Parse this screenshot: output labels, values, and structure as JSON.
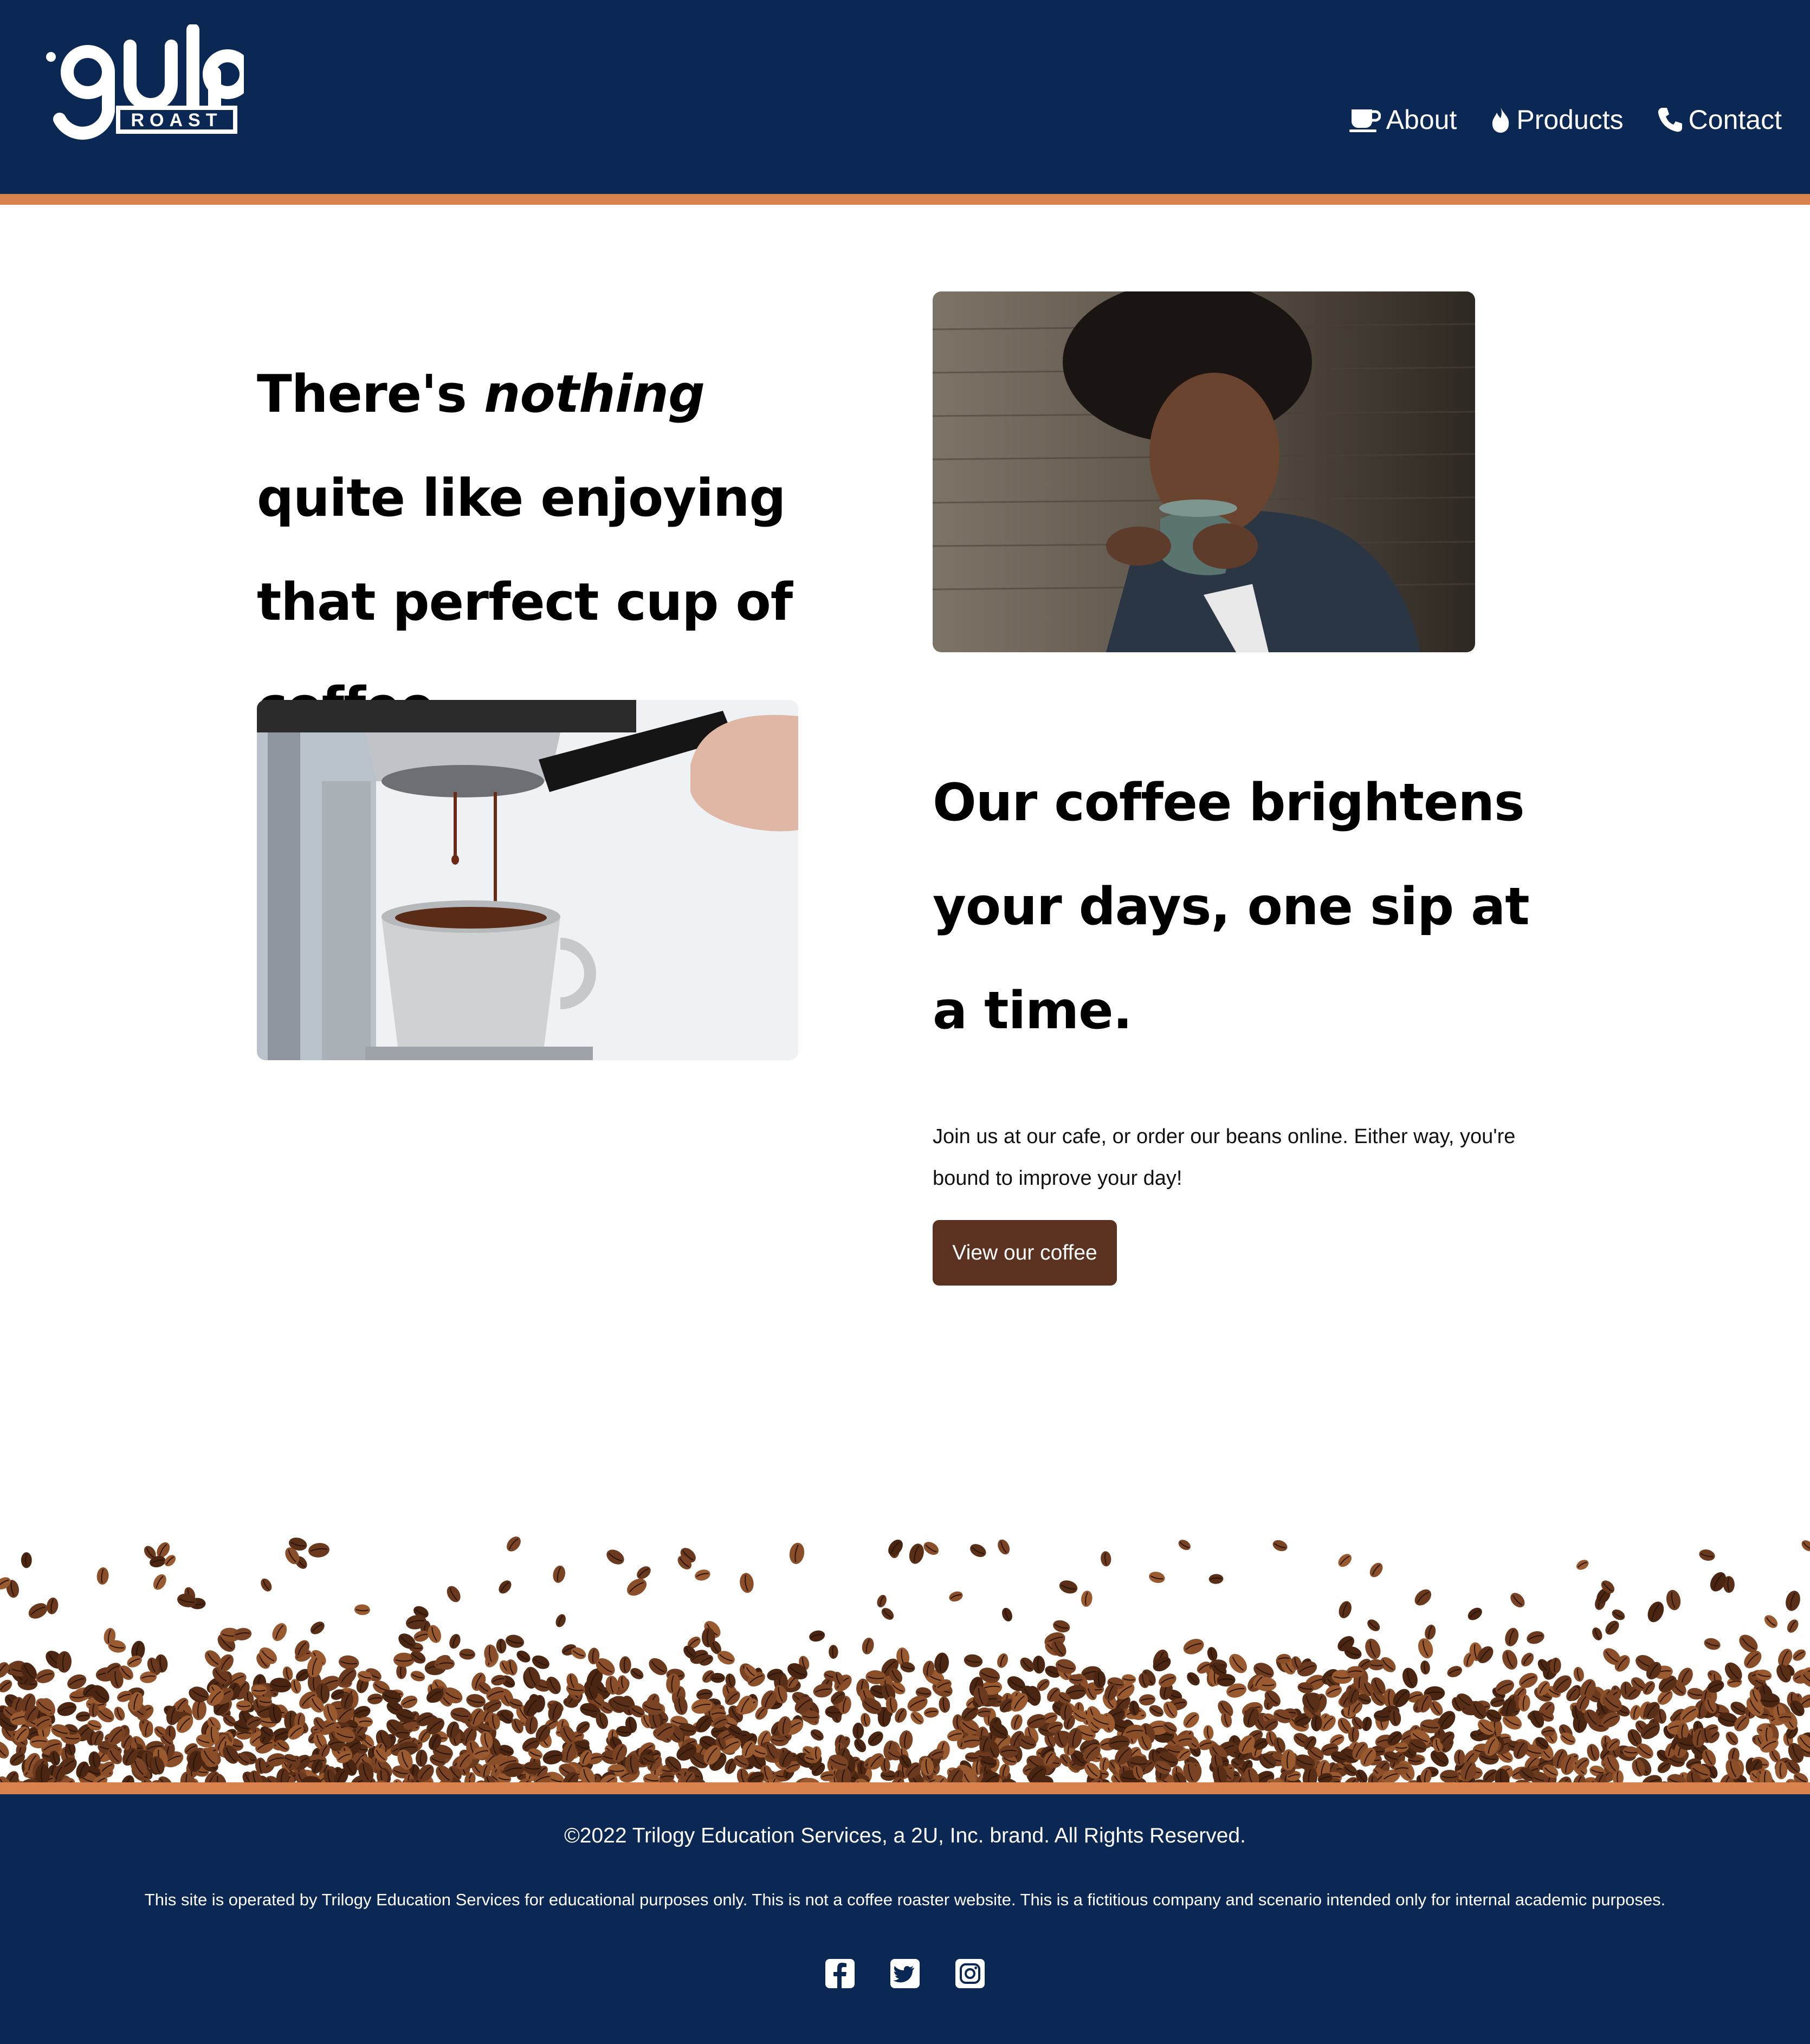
{
  "brand": {
    "logo_word": "gulp",
    "logo_sub": "ROAST",
    "colors": {
      "navy": "#0b2855",
      "accent": "#d9824e",
      "button": "#5b3120"
    }
  },
  "nav": {
    "items": [
      {
        "label": "About",
        "icon": "coffee-mug-icon"
      },
      {
        "label": "Products",
        "icon": "flame-icon"
      },
      {
        "label": "Contact",
        "icon": "phone-icon"
      }
    ]
  },
  "hero": {
    "headline_1_pre": "There's ",
    "headline_1_em": "nothing",
    "headline_1_post": " quite like enjoying that perfect cup of coffee.",
    "headline_2": "Our coffee brightens your days, one sip at a time.",
    "body": "Join us at our cafe, or order our beans online. Either way, you're bound to improve your day!",
    "cta_label": "View our coffee"
  },
  "footer": {
    "copyright": "©2022 Trilogy Education Services, a 2U, Inc. brand. All Rights Reserved.",
    "disclaimer": "This site is operated by Trilogy Education Services for educational purposes only. This is not a coffee roaster website. This is a fictitious company and scenario intended only for internal academic purposes.",
    "socials": [
      "facebook-icon",
      "twitter-icon",
      "instagram-icon"
    ]
  }
}
